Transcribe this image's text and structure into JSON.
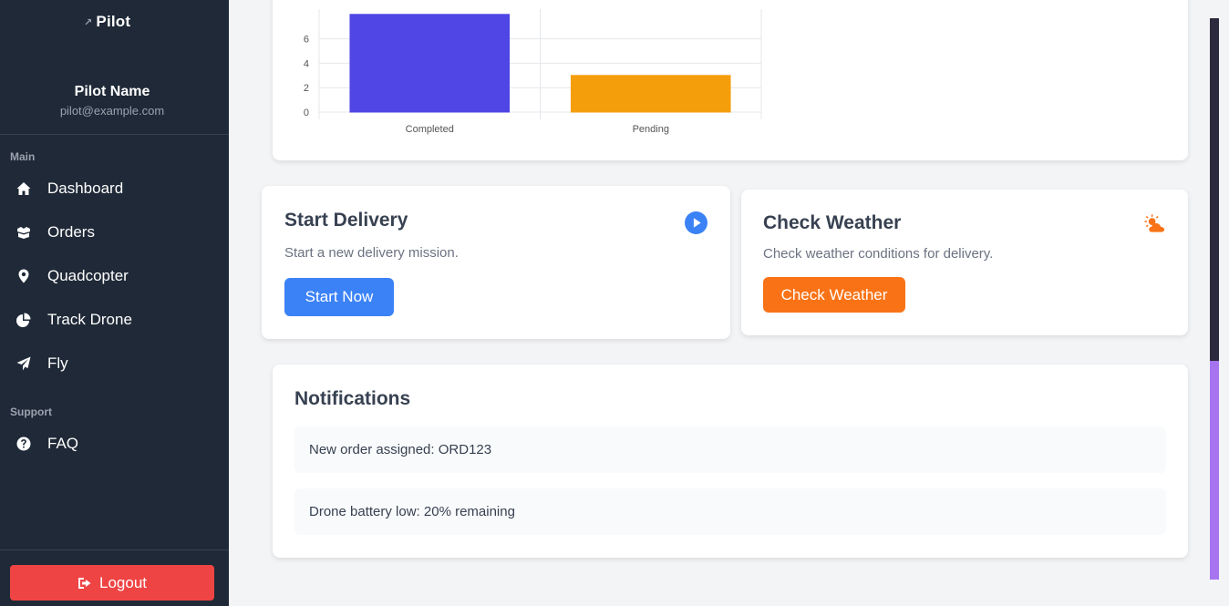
{
  "sidebar": {
    "brand": "Pilot",
    "profile": {
      "name": "Pilot Name",
      "email": "pilot@example.com"
    },
    "sections": {
      "main": "Main",
      "support": "Support"
    },
    "main_items": [
      {
        "label": "Dashboard",
        "icon": "home-icon"
      },
      {
        "label": "Orders",
        "icon": "boxes-icon"
      },
      {
        "label": "Quadcopter",
        "icon": "map-pin-icon"
      },
      {
        "label": "Track Drone",
        "icon": "pie-chart-icon"
      },
      {
        "label": "Fly",
        "icon": "paper-plane-icon"
      }
    ],
    "support_items": [
      {
        "label": "FAQ",
        "icon": "question-circle-icon"
      }
    ],
    "logout_label": "Logout"
  },
  "chart_data": {
    "type": "bar",
    "categories": [
      "Completed",
      "Pending"
    ],
    "values": [
      8,
      3
    ],
    "colors": [
      "#4f46e5",
      "#f59e0b"
    ],
    "yticks": [
      0,
      2,
      4,
      6
    ],
    "ylim": [
      0,
      8
    ]
  },
  "cards": {
    "start_delivery": {
      "title": "Start Delivery",
      "description": "Start a new delivery mission.",
      "button": "Start Now",
      "icon": "play-circle-icon"
    },
    "check_weather": {
      "title": "Check Weather",
      "description": "Check weather conditions for delivery.",
      "button": "Check Weather",
      "icon": "cloud-sun-icon"
    }
  },
  "notifications": {
    "title": "Notifications",
    "items": [
      "New order assigned: ORD123",
      "Drone battery low: 20% remaining"
    ]
  },
  "colors": {
    "sidebar_bg": "#1f2937",
    "blue": "#3b82f6",
    "orange": "#f97316",
    "logout_red": "#ef4444",
    "scroll_thumb": "#a774f0"
  }
}
